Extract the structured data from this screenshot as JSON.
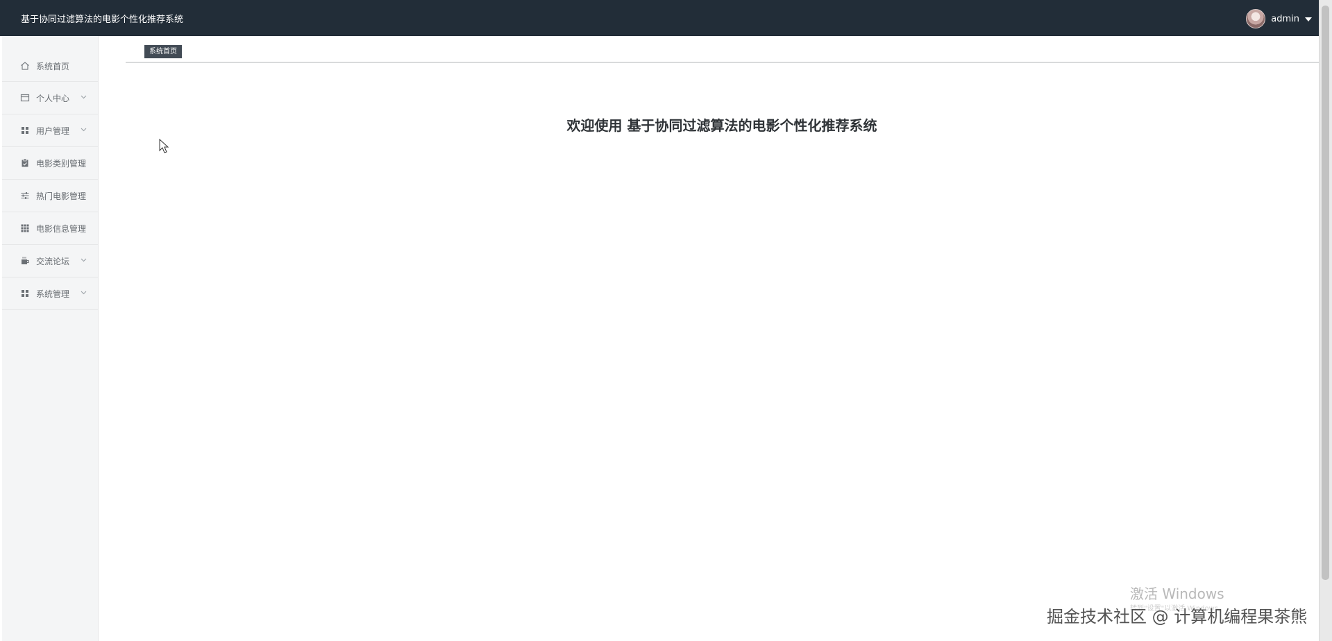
{
  "header": {
    "title": "基于协同过滤算法的电影个性化推荐系统",
    "username": "admin"
  },
  "sidebar": {
    "items": [
      {
        "label": "系统首页",
        "icon": "home-icon"
      },
      {
        "label": "个人中心",
        "icon": "wallet-icon",
        "expandable": true
      },
      {
        "label": "用户管理",
        "icon": "grid-icon",
        "expandable": true
      },
      {
        "label": "电影类别管理",
        "icon": "clipboard-icon"
      },
      {
        "label": "热门电影管理",
        "icon": "sliders-icon"
      },
      {
        "label": "电影信息管理",
        "icon": "apps-icon"
      },
      {
        "label": "交流论坛",
        "icon": "coffee-icon",
        "expandable": true
      },
      {
        "label": "系统管理",
        "icon": "grid-icon",
        "expandable": true
      }
    ]
  },
  "tabs": [
    {
      "label": "系统首页"
    }
  ],
  "main": {
    "welcome": "欢迎使用 基于协同过滤算法的电影个性化推荐系统"
  },
  "overlay": {
    "activate_title": "激活 Windows",
    "activate_sub": "转到\"设置\"以激活 Windows。",
    "watermark": "掘金技术社区 @ 计算机编程果茶熊"
  },
  "colors": {
    "topbar": "#222d38",
    "sidebar": "#f4f5f6",
    "tag": "#424b55",
    "text": "#2f3337"
  }
}
